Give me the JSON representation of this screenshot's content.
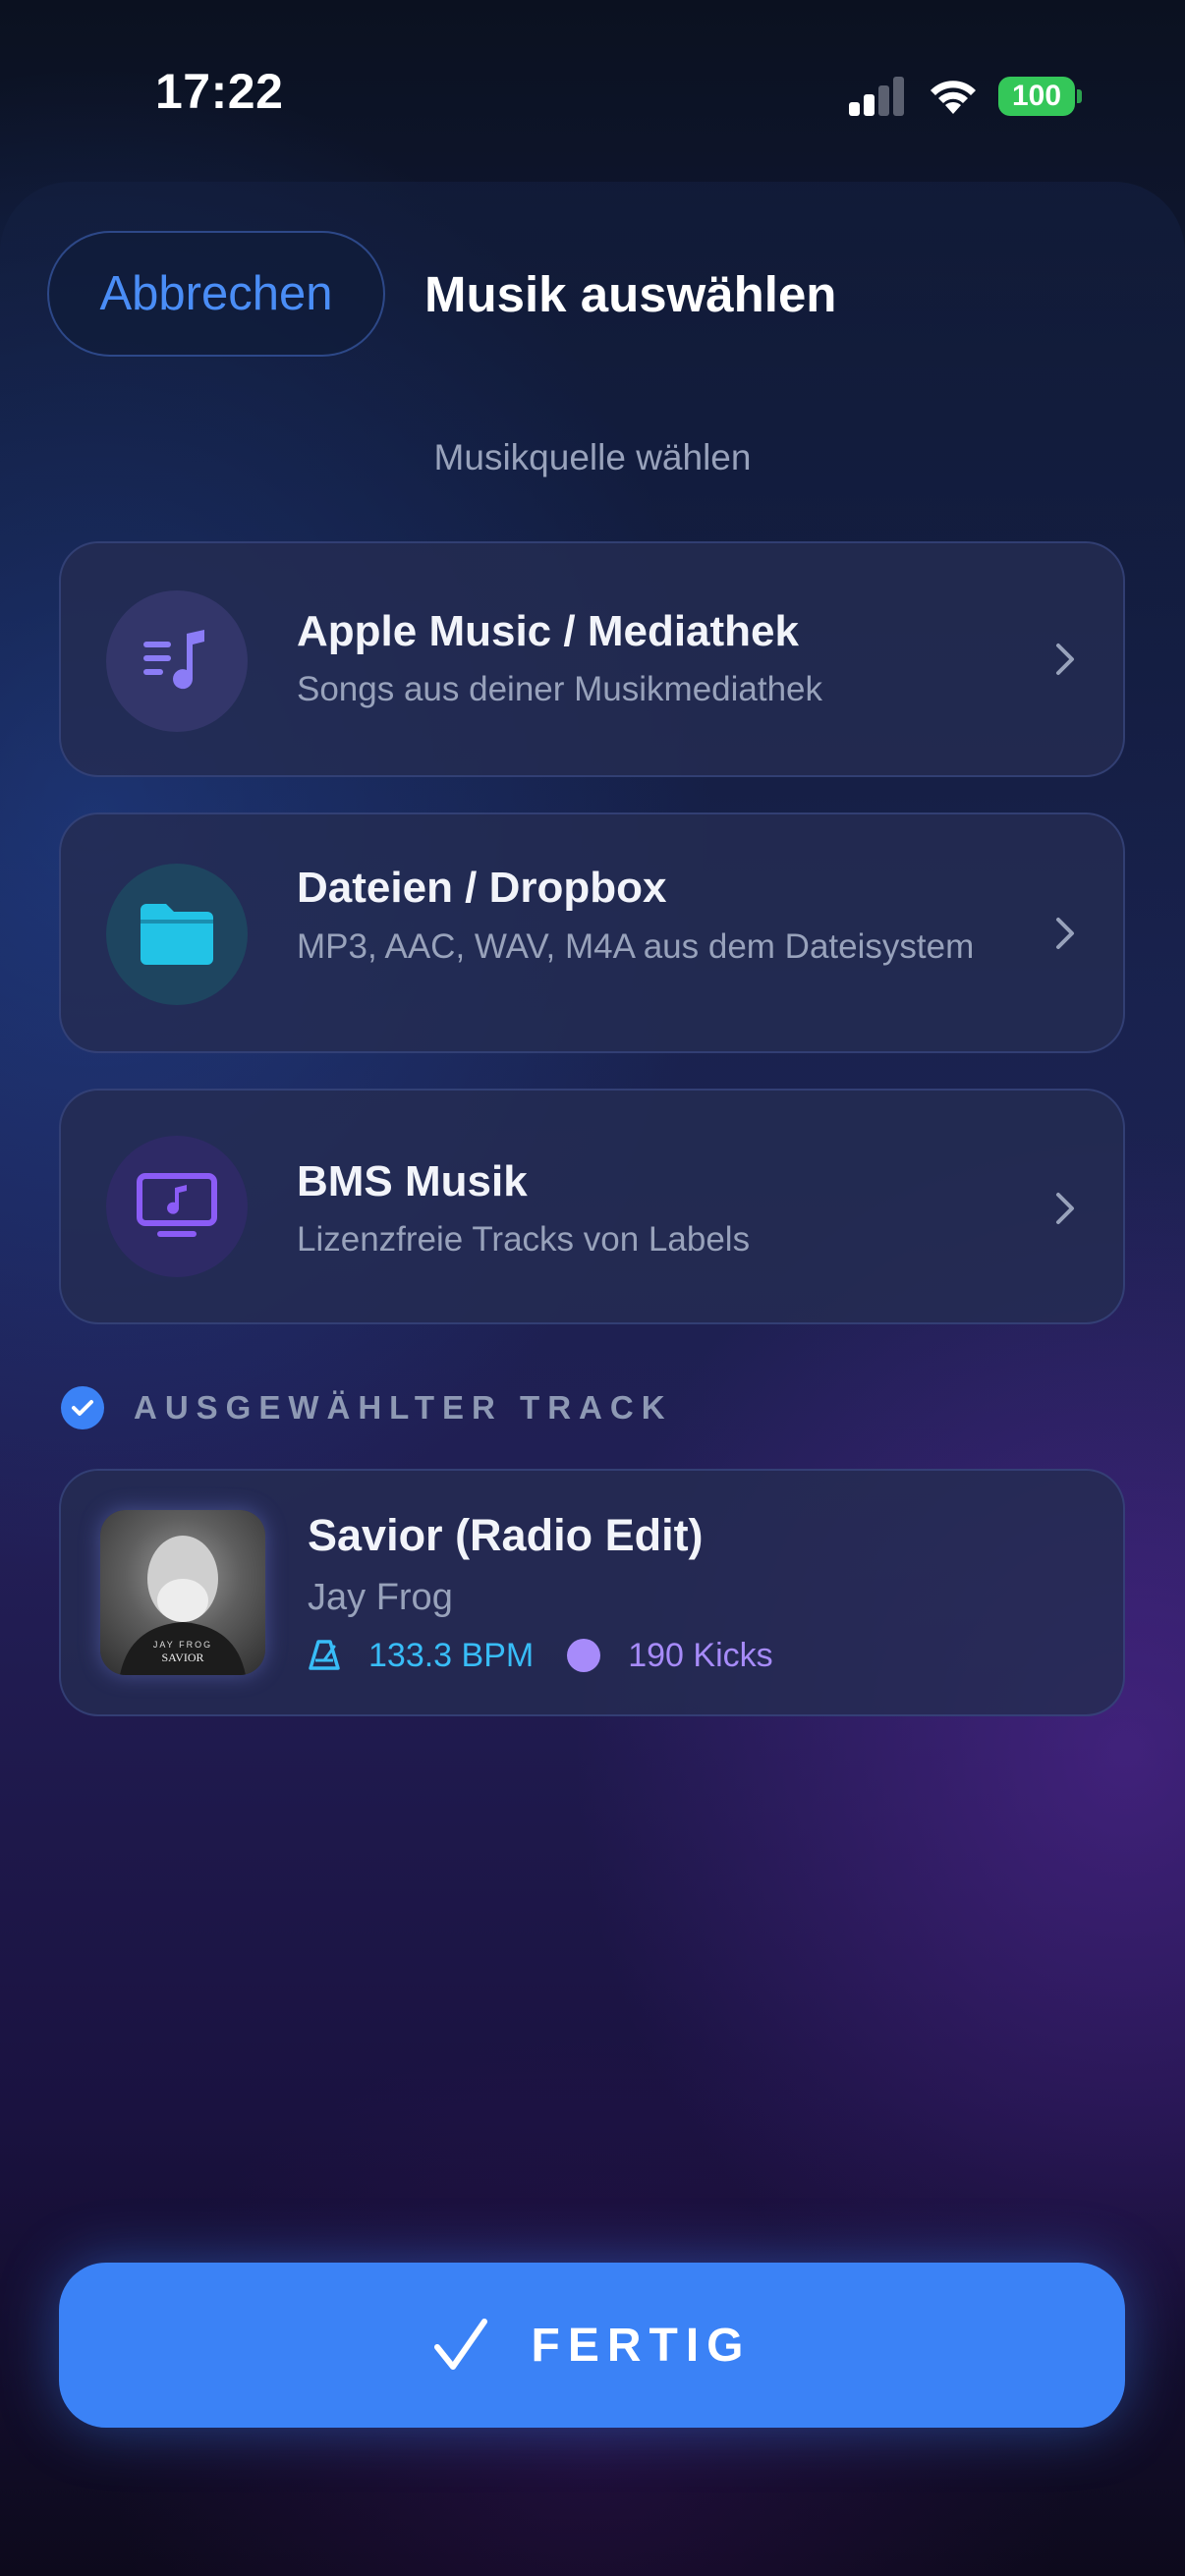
{
  "status_bar": {
    "time": "17:22",
    "battery": "100"
  },
  "header": {
    "cancel_label": "Abbrechen",
    "title": "Musik auswählen"
  },
  "section_hint": "Musikquelle wählen",
  "sources": [
    {
      "title": "Apple Music / Mediathek",
      "subtitle": "Songs aus deiner Musikmediathek",
      "icon": "music-list-icon",
      "color": "#8b7cf6"
    },
    {
      "title": "Dateien / Dropbox",
      "subtitle": "MP3, AAC, WAV, M4A aus dem Dateisystem",
      "icon": "folder-icon",
      "color": "#22c3e6"
    },
    {
      "title": "BMS Musik",
      "subtitle": "Lizenzfreie Tracks von Labels",
      "icon": "tv-music-icon",
      "color": "#8b5cf6"
    }
  ],
  "selected": {
    "label": "AUSGEWÄHLTER TRACK",
    "track_title": "Savior (Radio Edit)",
    "artist": "Jay Frog",
    "bpm": "133.3 BPM",
    "kicks": "190 Kicks",
    "cover_text_top": "JAY FROG",
    "cover_text_bottom": "SAVIOR"
  },
  "done_label": "FERTIG",
  "colors": {
    "accent": "#3b82f6",
    "bpm": "#38bdf8",
    "kicks": "#a78bfa",
    "battery": "#34c759"
  }
}
